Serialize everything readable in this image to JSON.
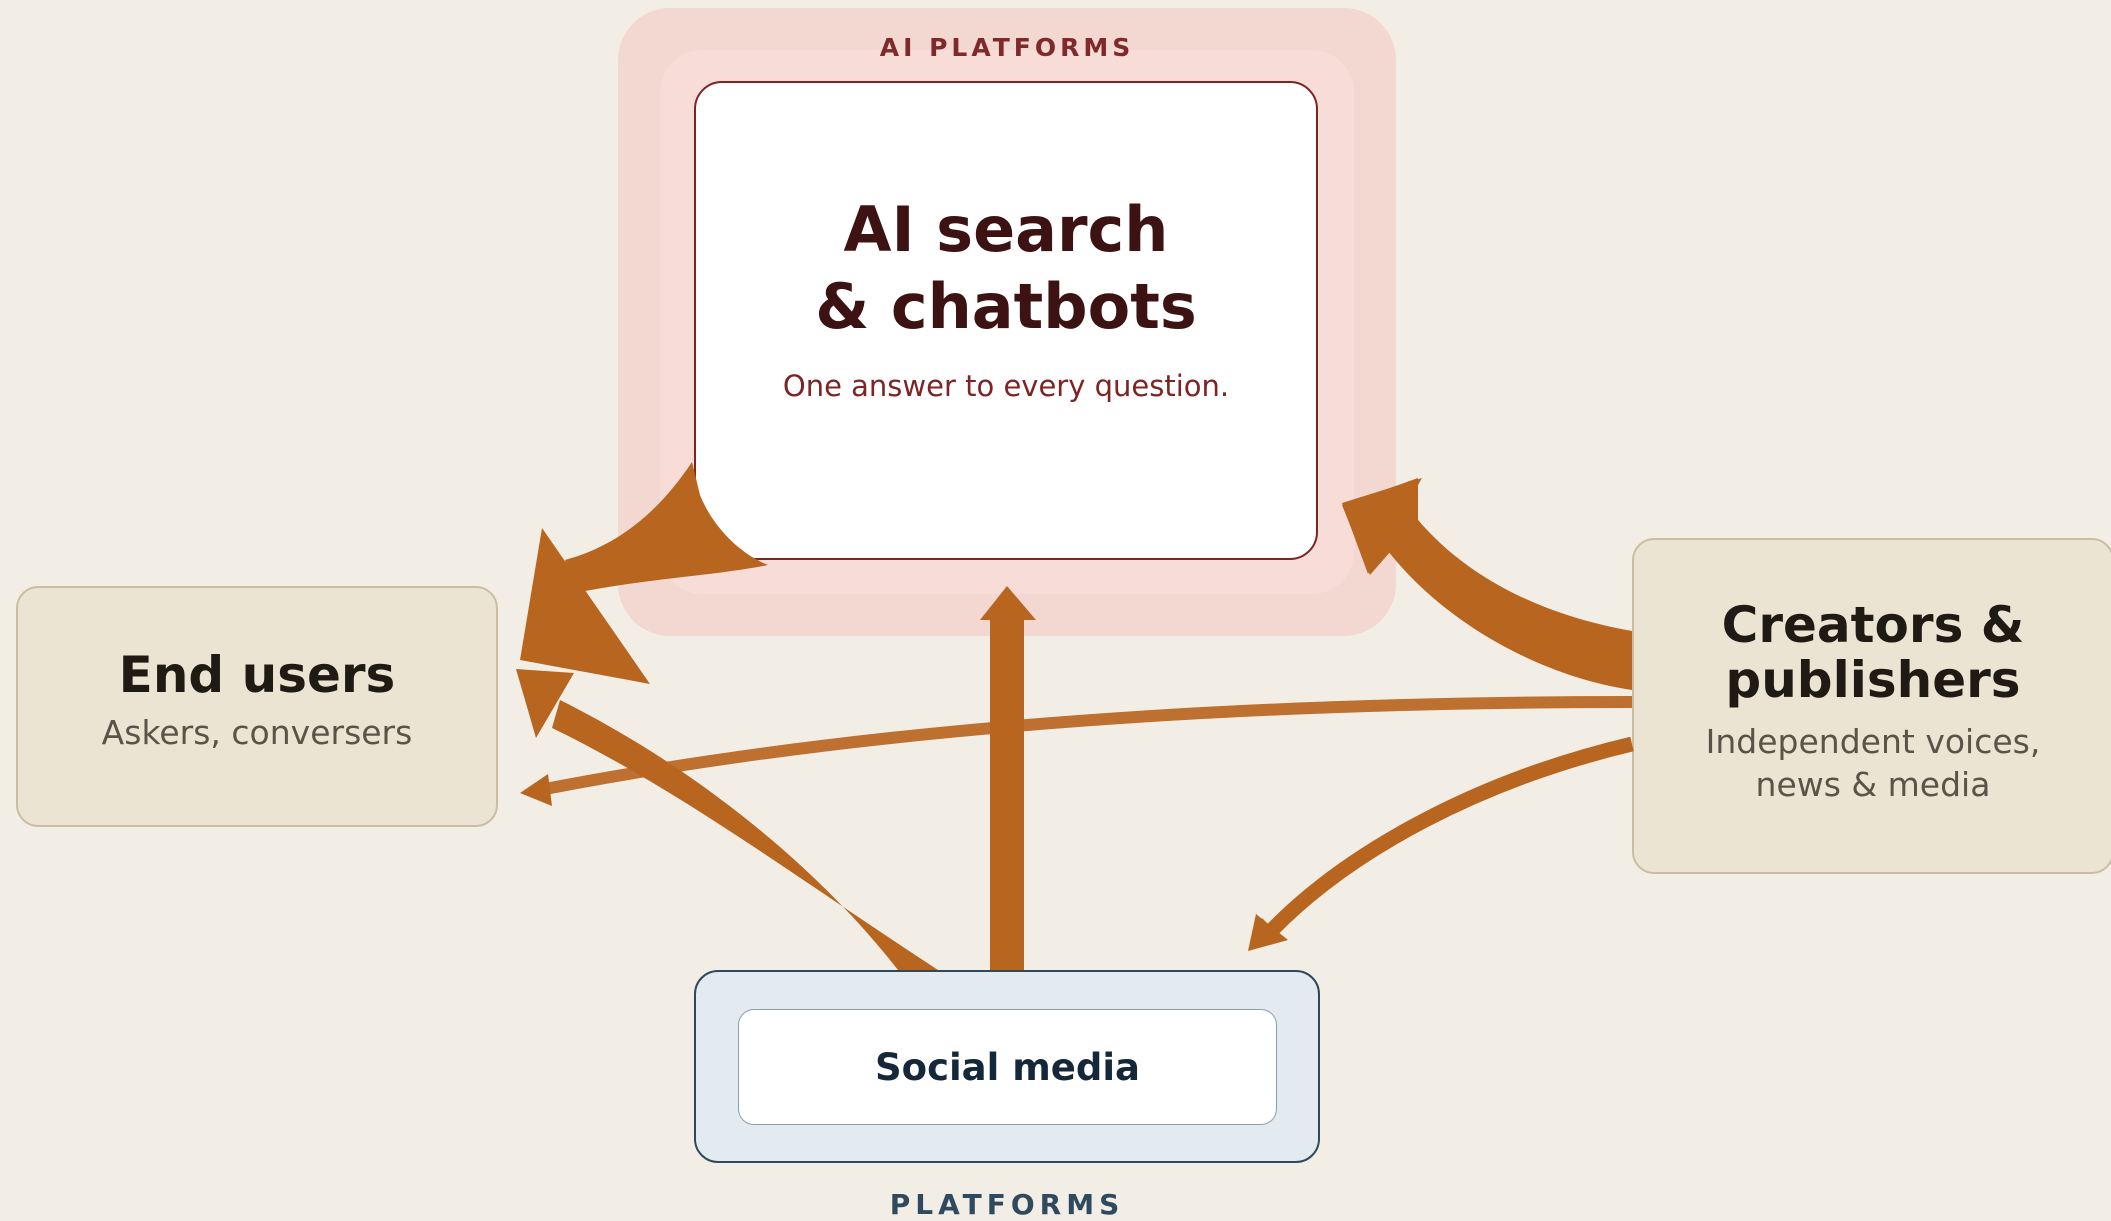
{
  "ai_platforms": {
    "group_label": "AI PLATFORMS",
    "title": "AI search\n& chatbots",
    "tagline": "One answer to every question."
  },
  "end_users": {
    "title": "End users",
    "subtitle": "Askers, conversers"
  },
  "creators": {
    "title": "Creators &\npublishers",
    "subtitle": "Independent voices,\nnews & media"
  },
  "platforms": {
    "group_label": "PLATFORMS",
    "social_media": "Social media"
  },
  "colors": {
    "background": "#f3eee5",
    "flow": "#b5601c",
    "ai_accent": "#7e2424",
    "platform_accent": "#2f4a5e"
  }
}
